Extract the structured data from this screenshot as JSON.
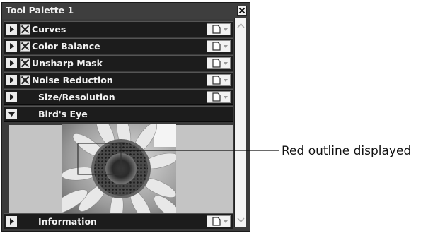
{
  "palette": {
    "title": "Tool Palette 1"
  },
  "tools": [
    {
      "label": "Curves",
      "checkbox": true
    },
    {
      "label": "Color Balance",
      "checkbox": true
    },
    {
      "label": "Unsharp Mask",
      "checkbox": true
    },
    {
      "label": "Noise Reduction",
      "checkbox": true
    },
    {
      "label": "Size/Resolution",
      "checkbox": false
    }
  ],
  "birds_eye": {
    "label": "Bird's Eye"
  },
  "information": {
    "label": "Information"
  },
  "callout": {
    "text": "Red outline displayed"
  }
}
